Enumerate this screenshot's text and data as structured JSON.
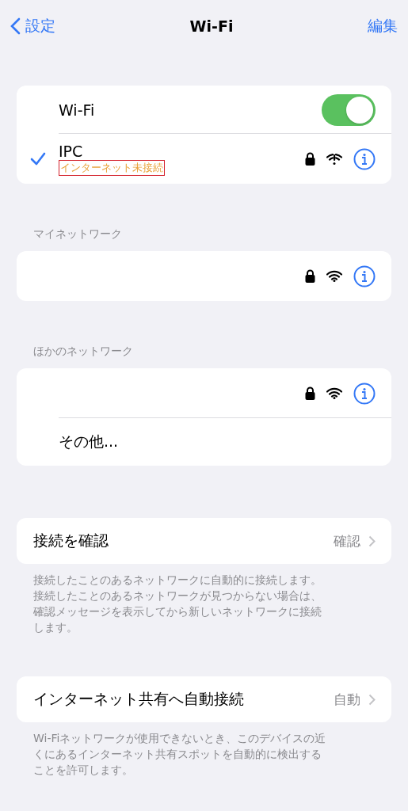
{
  "nav": {
    "back_label": "設定",
    "title": "Wi-Fi",
    "action": "編集"
  },
  "wifi": {
    "label": "Wi-Fi",
    "on": true
  },
  "current": {
    "name": "IPC",
    "status": "インターネット未接続",
    "status_highlighted": true,
    "checked": true,
    "icons": [
      {
        "kind": "lock"
      },
      {
        "kind": "wifi-warning"
      },
      {
        "kind": "info"
      }
    ]
  },
  "sections": [
    {
      "header": "マイネットワーク",
      "rows": [
        {
          "kind": "network",
          "icons": [
            {
              "kind": "lock"
            },
            {
              "kind": "wifi"
            },
            {
              "kind": "info"
            }
          ]
        }
      ]
    },
    {
      "header": "ほかのネットワーク",
      "rows": [
        {
          "kind": "network",
          "icons": [
            {
              "kind": "lock"
            },
            {
              "kind": "wifi"
            },
            {
              "kind": "info"
            }
          ]
        },
        {
          "kind": "other",
          "label": "その他..."
        }
      ]
    }
  ],
  "settings": [
    {
      "label": "接続を確認",
      "value": "確認",
      "footer_lines": [
        "接続したことのあるネットワークに自動的に接続します。",
        "接続したことのあるネットワークが見つからない場合は、",
        "確認メッセージを表示してから新しいネットワークに接続",
        "します。"
      ]
    },
    {
      "label": "インターネット共有へ自動接続",
      "value": "自動",
      "footer_lines": [
        "Wi-Fiネットワークが使用できないとき、このデバイスの近",
        "くにあるインターネット共有スポットを自動的に検出する",
        "ことを許可します。"
      ]
    }
  ]
}
